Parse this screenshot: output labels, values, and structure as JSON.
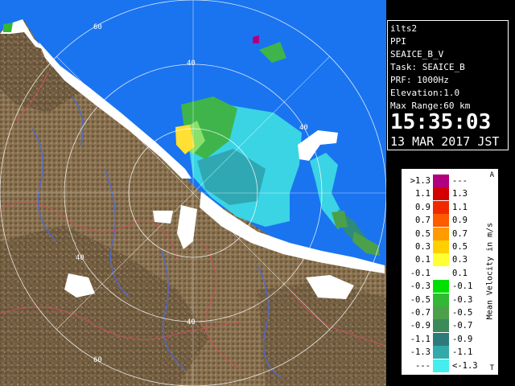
{
  "info": {
    "site": "ilts2",
    "mode": "PPI",
    "product": "SEAICE_B_V",
    "task": "Task: SEAICE_B",
    "prf": "PRF: 1000Hz",
    "elevation": "Elevation:1.0",
    "max_range": "Max Range:60 km",
    "time": "15:35:03",
    "date": "13 MAR 2017 JST"
  },
  "legend": {
    "unit": "Mean Velocity in m/s",
    "corner_top": "A",
    "corner_bottom": "T",
    "rows": [
      {
        "left": ">1.3",
        "right": "---",
        "color": "#b0007f"
      },
      {
        "left": "1.1",
        "right": "1.3",
        "color": "#d40000"
      },
      {
        "left": "0.9",
        "right": "1.1",
        "color": "#f02800"
      },
      {
        "left": "0.7",
        "right": "0.9",
        "color": "#ff5a00"
      },
      {
        "left": "0.5",
        "right": "0.7",
        "color": "#ff9a00"
      },
      {
        "left": "0.3",
        "right": "0.5",
        "color": "#ffd000"
      },
      {
        "left": "0.1",
        "right": "0.3",
        "color": "#ffff33"
      },
      {
        "left": "-0.1",
        "right": "0.1",
        "color": "#ffffff"
      },
      {
        "left": "-0.3",
        "right": "-0.1",
        "color": "#00e000"
      },
      {
        "left": "-0.5",
        "right": "-0.3",
        "color": "#33b833"
      },
      {
        "left": "-0.7",
        "right": "-0.5",
        "color": "#4ca04c"
      },
      {
        "left": "-0.9",
        "right": "-0.7",
        "color": "#3c8a5a"
      },
      {
        "left": "-1.1",
        "right": "-0.9",
        "color": "#2e7a7a"
      },
      {
        "left": "-1.3",
        "right": "-1.1",
        "color": "#33aaaa"
      },
      {
        "left": "---",
        "right": "<-1.3",
        "color": "#44eeee"
      }
    ]
  },
  "map": {
    "range_labels": [
      "60",
      "40",
      "40",
      "40",
      "40",
      "60"
    ],
    "colors": {
      "sea": "#1a74f0",
      "land": "#8a7250",
      "grid": "#ffffff",
      "river": "#4a6ad8",
      "road": "#c8505a"
    }
  }
}
